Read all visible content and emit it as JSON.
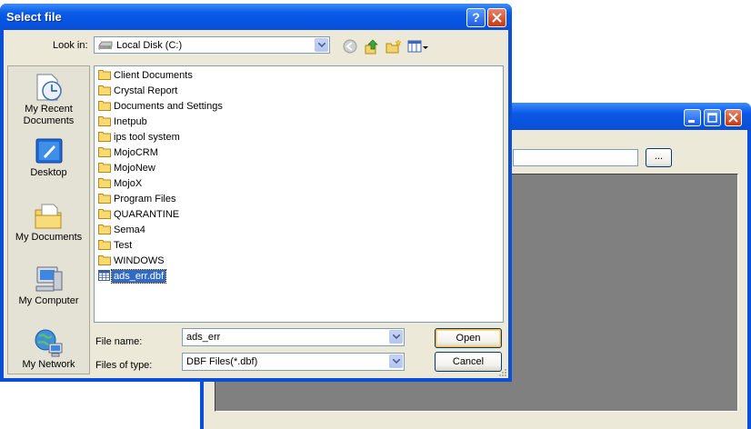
{
  "dialog": {
    "title": "Select file",
    "look_in_label": "Look in:",
    "look_in_value": "Local Disk (C:)",
    "places": [
      {
        "label": "My Recent Documents",
        "icon": "recent-documents-icon"
      },
      {
        "label": "Desktop",
        "icon": "desktop-icon"
      },
      {
        "label": "My Documents",
        "icon": "my-documents-icon"
      },
      {
        "label": "My Computer",
        "icon": "my-computer-icon"
      },
      {
        "label": "My Network",
        "icon": "my-network-icon"
      }
    ],
    "files": [
      {
        "name": "Client Documents",
        "type": "folder"
      },
      {
        "name": "Crystal Report",
        "type": "folder"
      },
      {
        "name": "Documents and Settings",
        "type": "folder"
      },
      {
        "name": "Inetpub",
        "type": "folder"
      },
      {
        "name": "ips tool system",
        "type": "folder"
      },
      {
        "name": "MojoCRM",
        "type": "folder"
      },
      {
        "name": "MojoNew",
        "type": "folder"
      },
      {
        "name": "MojoX",
        "type": "folder"
      },
      {
        "name": "Program Files",
        "type": "folder"
      },
      {
        "name": "QUARANTINE",
        "type": "folder"
      },
      {
        "name": "Sema4",
        "type": "folder"
      },
      {
        "name": "Test",
        "type": "folder"
      },
      {
        "name": "WINDOWS",
        "type": "folder"
      },
      {
        "name": "ads_err.dbf",
        "type": "file",
        "selected": true
      }
    ],
    "file_name_label": "File name:",
    "file_name_value": "ads_err",
    "file_type_label": "Files of type:",
    "file_type_value": "DBF Files(*.dbf)",
    "open_label": "Open",
    "cancel_label": "Cancel",
    "help_label": "?"
  },
  "background_window": {
    "browse_label": "..."
  },
  "colors": {
    "titlebar": "#0a4fd6",
    "client": "#ece9d8",
    "selection": "#316ac5",
    "close": "#c43a12"
  }
}
